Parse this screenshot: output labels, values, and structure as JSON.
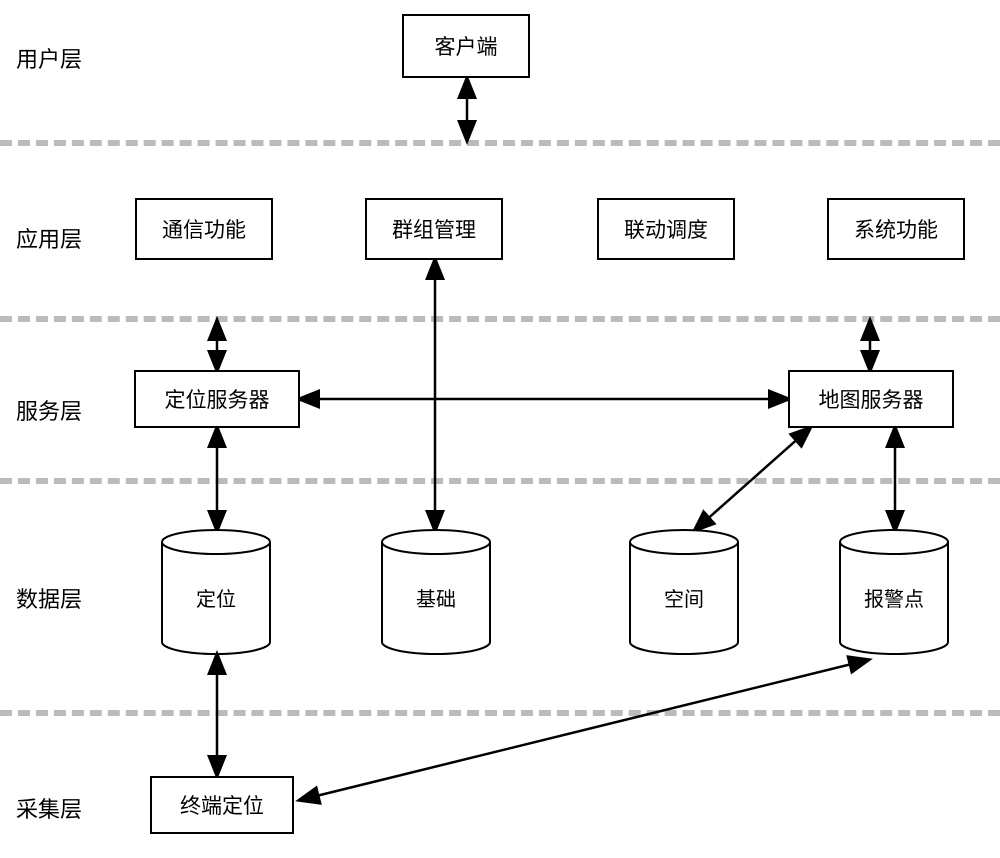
{
  "layers": {
    "user": "用户层",
    "app": "应用层",
    "service": "服务层",
    "data": "数据层",
    "collect": "采集层"
  },
  "client": "客户端",
  "app_boxes": {
    "comm": "通信功能",
    "group": "群组管理",
    "linkage": "联动调度",
    "system": "系统功能"
  },
  "service_boxes": {
    "loc_server": "定位服务器",
    "map_server": "地图服务器"
  },
  "data_cyl": {
    "loc": "定位",
    "base": "基础",
    "space": "空间",
    "alarm": "报警点"
  },
  "collect_box": {
    "terminal": "终端定位"
  }
}
